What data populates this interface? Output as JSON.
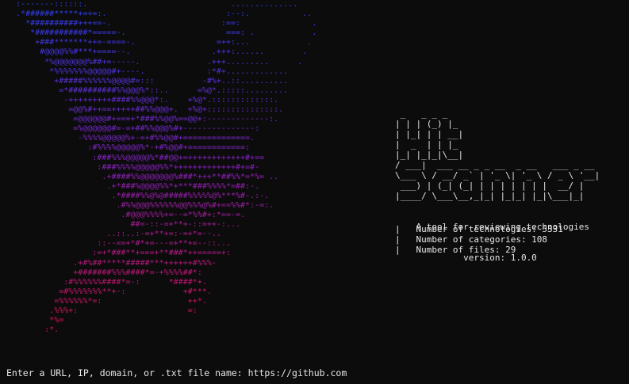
{
  "colors": {
    "background": "#0c0c0c",
    "text": "#e6e6e6",
    "art_gradient": [
      "#2c3ff0",
      "#8a21c0",
      "#d8134f"
    ]
  },
  "ascii_art": [
    "  :-------::::::.                              ..............",
    "  .*######*****+=+=:.                         :--:.           ..",
    "    *##########+++==-.                       :==:               .",
    "     *###########*=====-.                     ===: .            .",
    "      +###*******++=-====-.                 =++:...            .",
    "       #@@@@%%#***+====--.                 .+++:......        .",
    "        *%@@@@@@@%##+=-----.              .+++.........      .",
    "         *%%%%%%%@@@@@#+----.             :*#+.............",
    "          +#####%%%%%%@@@@#=:::          -#%+..::..........",
    "           =*##########%%@@@%*::..      =%@*.:::::.........",
    "            -+++++++++####%%@@@*:.    +%@*.:::::::::::::.",
    "             =@@%#++==+++++##%%@@@+.  +%@+:::::::::::::::.",
    "              =@@@@@@#+===+*###%%@@%==@@+:-------------:.",
    "              =%@@@@@@#=-=+##%%@@@%#+---------------:",
    "               -%%%%@@@@@%+-=+#%%@@#+==============.",
    "                 :#%%%%@@@@@%*-+#%@@#+============:",
    "                  :###%%%@@@@@%*##@@+=++++++++++++#+==",
    "                   :###%%%%@@@@@%%*+++++++++++++#+=#-",
    "                    .+####%%@@@@@@@%###*+++**##%%*=*%= ..",
    "                     .+*###%@@@@%%*+***###%%%%*=##:-.",
    "                      .*####%%@%@#####%%%%%@%***%#-.:-.",
    "                       .#%%@@@%%%%%%@@%%%@%#+==%%#*:-=:.",
    "                        .#@@@%%%%+=--=*%%#+:*==-=.",
    "                          ##=-::-=+**+-::=++-:...",
    "                     ..::..:-=+**+=:-=+*=--..",
    "                   ::--==+*#*+=---=+**+=--::...",
    "                  :=+*###**+===+**###*++=====+:",
    "              .+#%##*****#####***++++++#%%%-",
    "              +#######%%%####*=-+%%%%##*:",
    "            :#%%%%%%####*=-:      *####*+.",
    "           =#%%%%%%%**+-:            +#***.",
    "          =%%%%%%*=:                  ++*.",
    "         .%%%+:                       =:",
    "         *%=",
    "        :*."
  ],
  "banner_lines": [
    " _   _ _ _",
    "| | | (_) |_",
    "| |_| | | __|",
    "|  _  | | |_",
    "|_| |_|_|\\__|",
    "/ ___|  ___ __ _ _ __  _ __   ___ _ __",
    "\\___ \\ / __/ _` | '_ \\| '_ \\ / _ \\ '__|",
    " ___) | (_| (_| | | | | | | |  __/ |",
    "|____/ \\___\\__,_|_| |_|_| |_|\\___|_|"
  ],
  "tagline": "    A tool for reviewing technologies",
  "version": "             version: 1.0.0",
  "stats": [
    "|   Number of technologies: 5331",
    "|   Number of categories: 108",
    "|   Number of files: 29"
  ],
  "prompt": "Enter a URL, IP, domain, or .txt file name: https://github.com"
}
